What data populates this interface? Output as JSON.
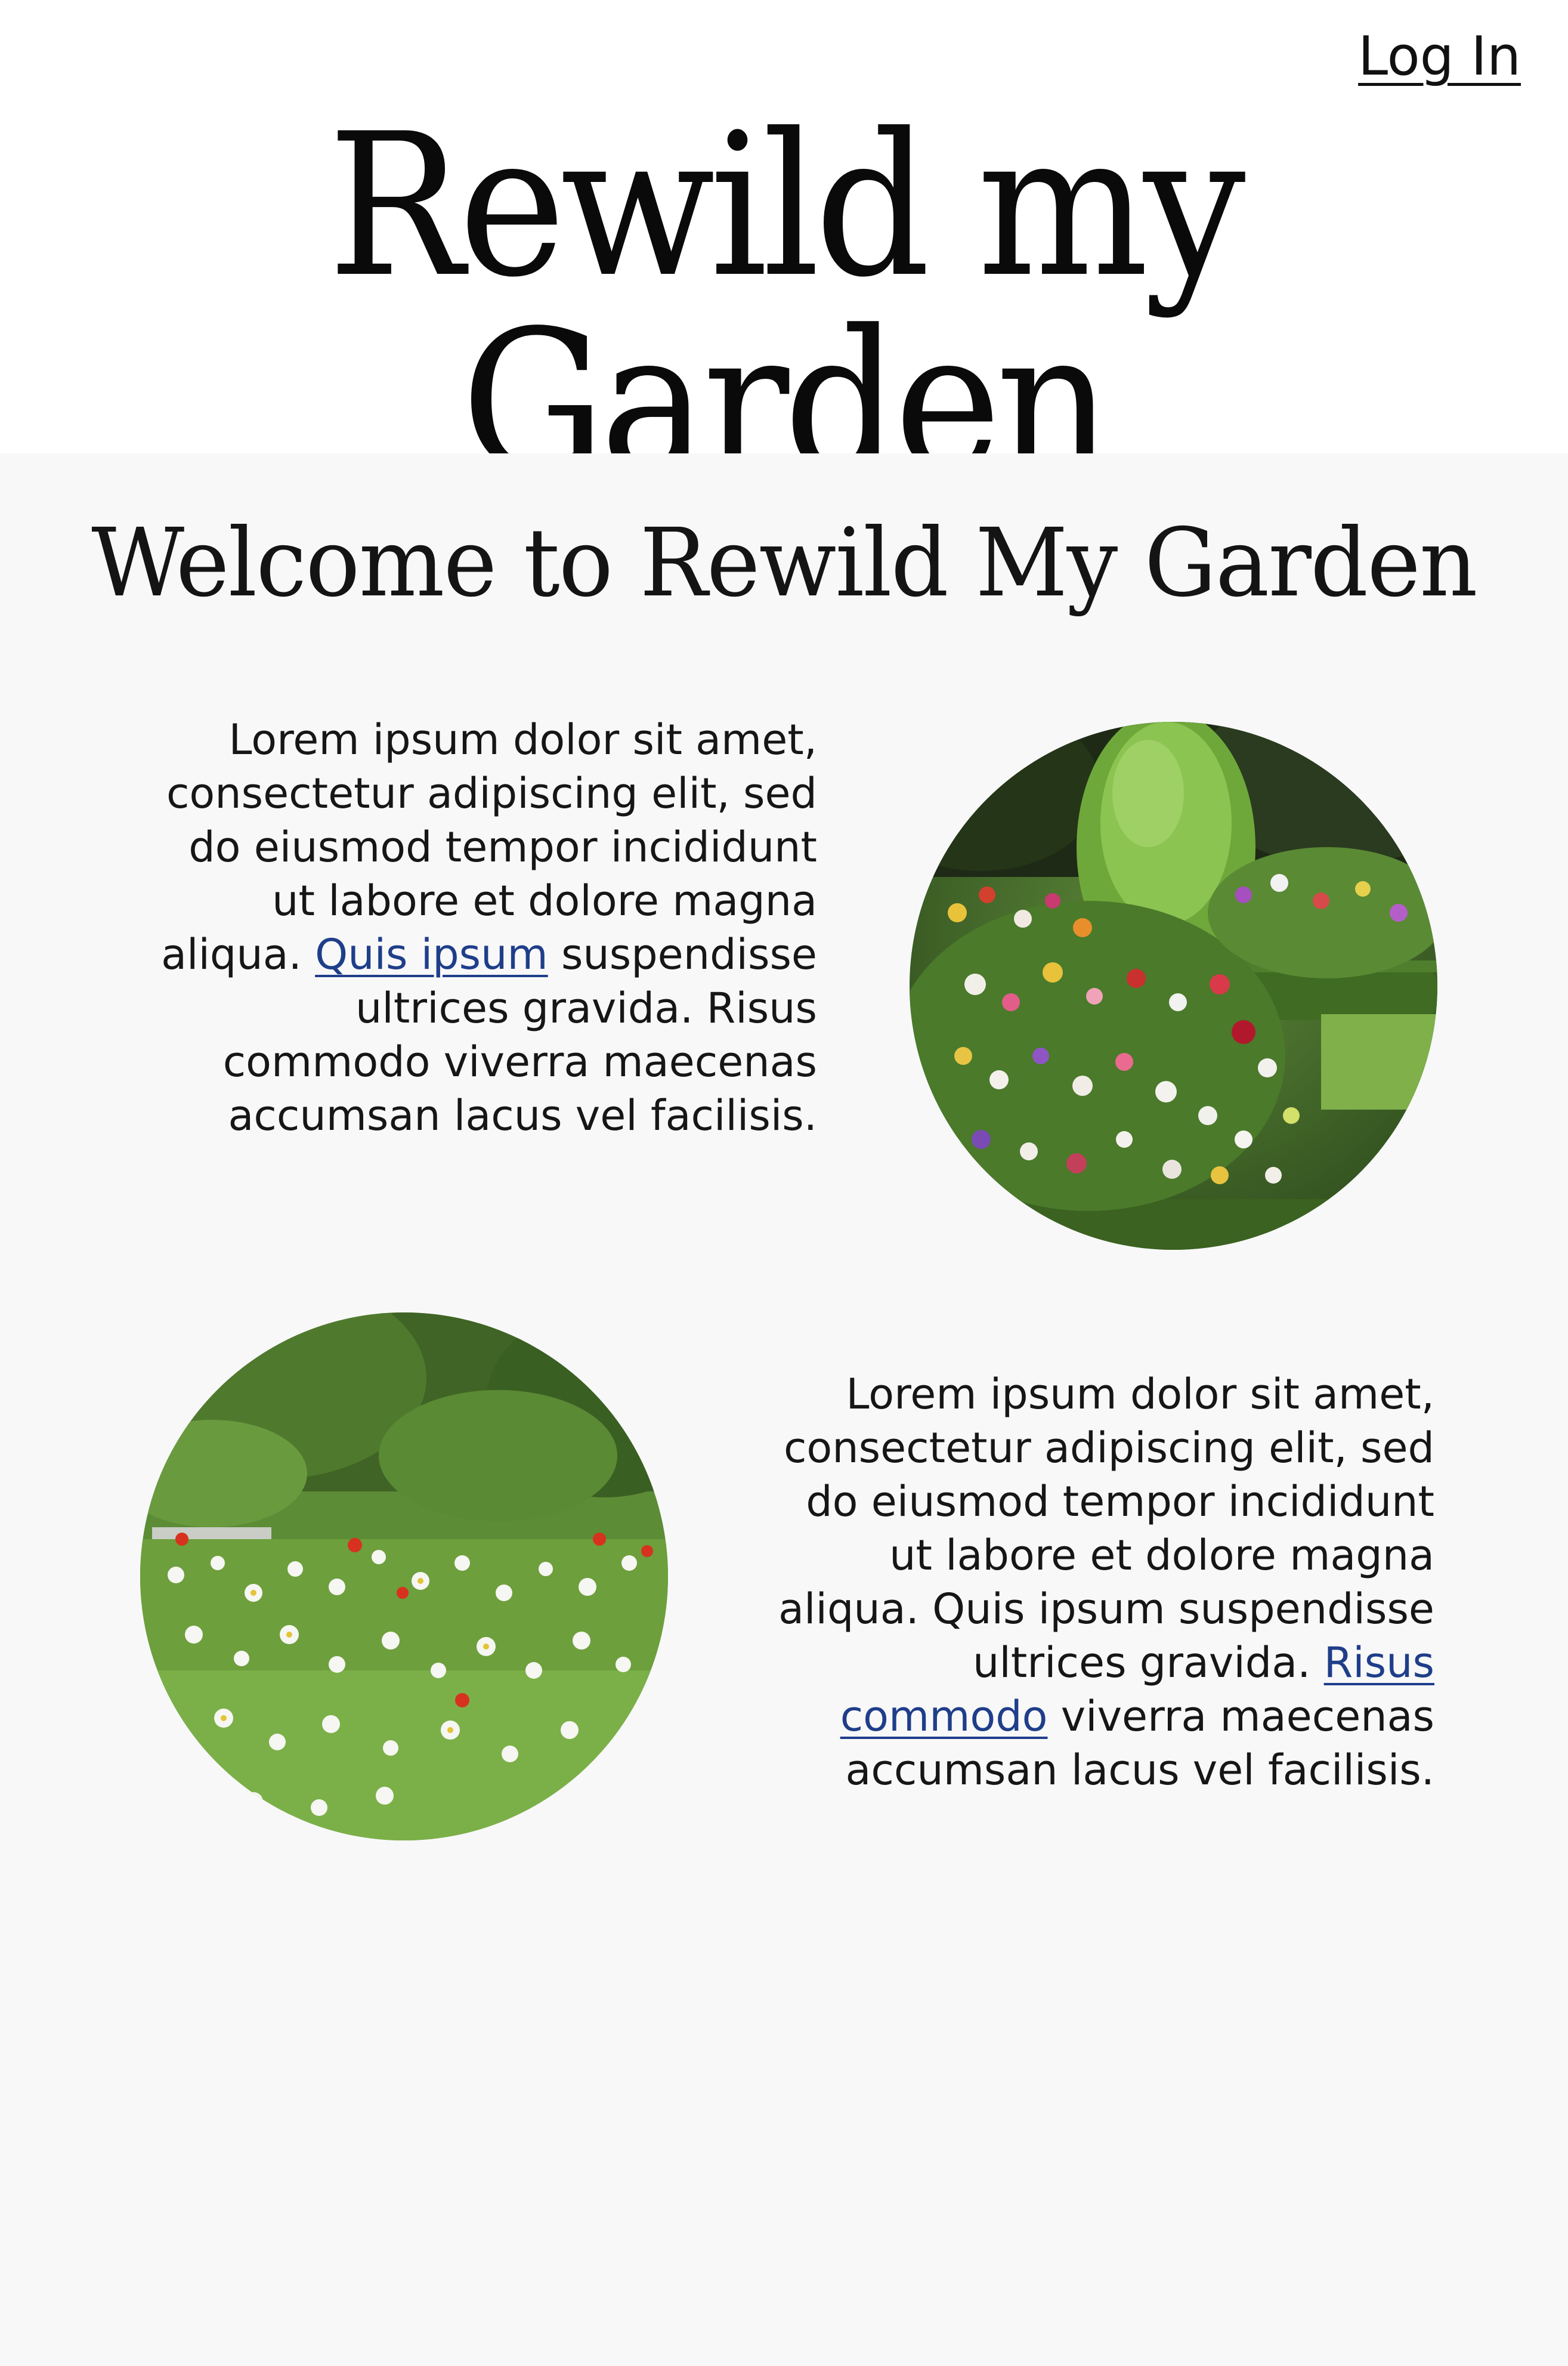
{
  "header": {
    "login_label": "Log In",
    "site_title": "Rewild my Garden"
  },
  "main": {
    "welcome_heading": "Welcome to Rewild My Garden",
    "sections": [
      {
        "text_before_link": "Lorem ipsum dolor sit amet, consectetur adipiscing elit, sed do eiusmod tempor incididunt ut labore et dolore magna aliqua. ",
        "link_text": "Quis ipsum",
        "text_after_link": " suspendisse ultrices gravida. Risus commodo viverra maecenas accumsan lacus vel facilisis."
      },
      {
        "text_before_link": "Lorem ipsum dolor sit amet, consectetur adipiscing elit, sed do eiusmod tempor incididunt ut labore et dolore magna aliqua. Quis ipsum suspendisse ultrices gravida. ",
        "link_text": "Risus commodo",
        "text_after_link": " viverra maecenas accumsan lacus vel facilisis."
      }
    ]
  },
  "colors": {
    "header_bg": "#ffffff",
    "main_bg": "#f8f8f8",
    "text": "#161616",
    "link": "#1f3e8a"
  }
}
